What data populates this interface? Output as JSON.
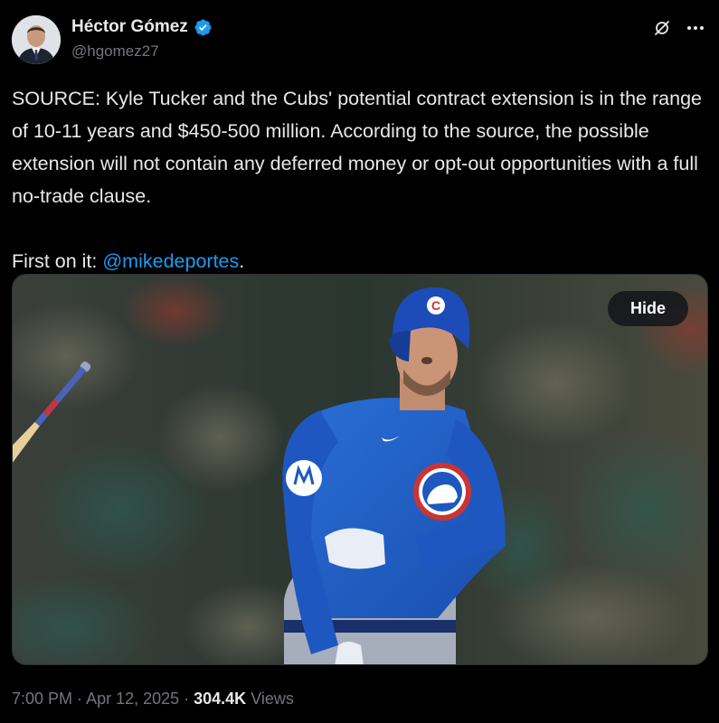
{
  "author": {
    "display_name": "Héctor Gómez",
    "handle": "@hgomez27",
    "verified": true,
    "verified_color": "#1d9bf0"
  },
  "tweet": {
    "text_line1": "SOURCE: Kyle Tucker and the Cubs' potential contract extension is in the range of 10-11 years and $450-500 million. According to the source, the possible extension will not contain any deferred money or opt-out opportunities with a full no-trade clause.",
    "text_line2_prefix": "First on it: ",
    "mention": "@mikedeportes",
    "text_line2_suffix": "."
  },
  "media": {
    "hide_label": "Hide",
    "jersey_letter": "C"
  },
  "footer": {
    "time": "7:00 PM",
    "sep1": " · ",
    "date": "Apr 12, 2025",
    "sep2": " · ",
    "views_count": "304.4K",
    "views_label": " Views"
  },
  "icons": {
    "grok": "grok-icon",
    "more": "more-icon",
    "verified": "verified-badge-icon"
  },
  "colors": {
    "background": "#000000",
    "text": "#e7e9ea",
    "secondary": "#71767b",
    "link": "#1d9bf0",
    "cubs_blue": "#1e5ec8",
    "cubs_red": "#cc3433"
  }
}
